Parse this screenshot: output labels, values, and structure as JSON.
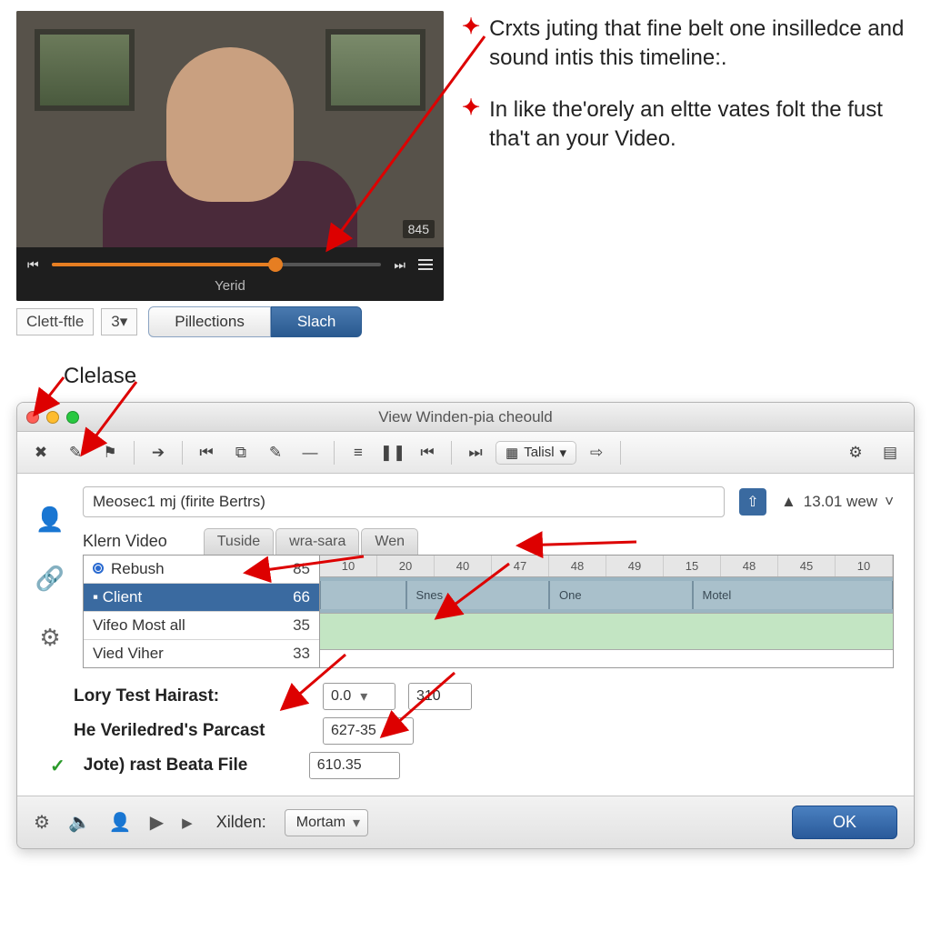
{
  "callouts": {
    "item1": "Crxts juting that fine belt one insilledce and sound intis this timeline:.",
    "item2": "In like the'orely an eltte vates folt the fust tha't an your Video."
  },
  "clelase_label": "Clelase",
  "player": {
    "overlay_number": "845",
    "caption": "Yerid",
    "under": {
      "clett_ftle": "Clett-ftle",
      "three": "3▾",
      "pillections": "Pillections",
      "slach": "Slach"
    }
  },
  "window": {
    "title": "View Winden-pia cheould",
    "toolbar_combo": "Talisl",
    "project_name": "Meosec1 mj (firite Bertrs)",
    "status_value": "13.01 wew",
    "klern_video": "Klern Video",
    "tabs": {
      "t1": "Tuside",
      "t2": "wra-sara",
      "t3": "Wen"
    },
    "list": {
      "r1_label": "Rebush",
      "r1_val": "85",
      "r2_label": "Client",
      "r2_val": "66",
      "r3_label": "Vifeo Most all",
      "r3_val": "35",
      "r4_label": "Vied Viher",
      "r4_val": "33"
    },
    "ruler": [
      "10",
      "20",
      "40",
      "47",
      "48",
      "49",
      "15",
      "48",
      "45",
      "10"
    ],
    "clips": {
      "c1": "Snes",
      "c2": "One",
      "c3": "Motel"
    },
    "form": {
      "l1": "Lory Test Hairast:",
      "v1a": "0.0",
      "v1b": "310",
      "l2": "He Veriledred's Parcast",
      "v2": "627-35",
      "l3": "Jote) rast Beata File",
      "v3": "610.35"
    },
    "footer": {
      "xilden": "Xilden:",
      "mortam": "Mortam",
      "ok": "OK"
    }
  }
}
